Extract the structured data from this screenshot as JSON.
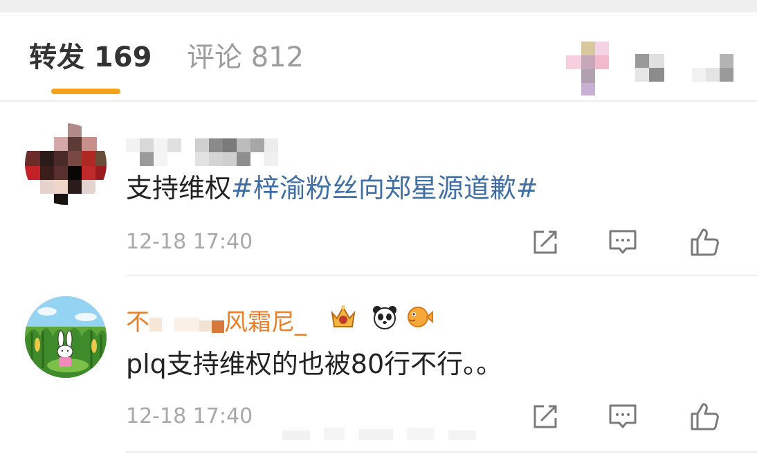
{
  "tabs": [
    {
      "label": "转发 169"
    },
    {
      "label": "评论 812"
    }
  ],
  "comments": [
    {
      "content_text": "支持维权",
      "content_hashtag": "#梓渝粉丝向郑星源道歉#",
      "time": "12-18 17:40"
    },
    {
      "username_prefix": "不",
      "username_suffix": "风霜尼_",
      "content_text": "plq支持维权的也被80行不行。。",
      "time": "12-18 17:40"
    }
  ],
  "icons": {
    "share": "share-icon",
    "comment": "comment-icon",
    "like": "thumbs-up-icon"
  },
  "colors": {
    "active_tab": "#333333",
    "inactive_tab": "#9c9c9c",
    "tab_indicator": "#f4a11b",
    "hashtag": "#3f6fa5",
    "username": "#e8802a",
    "timestamp": "#a8a8a8"
  }
}
